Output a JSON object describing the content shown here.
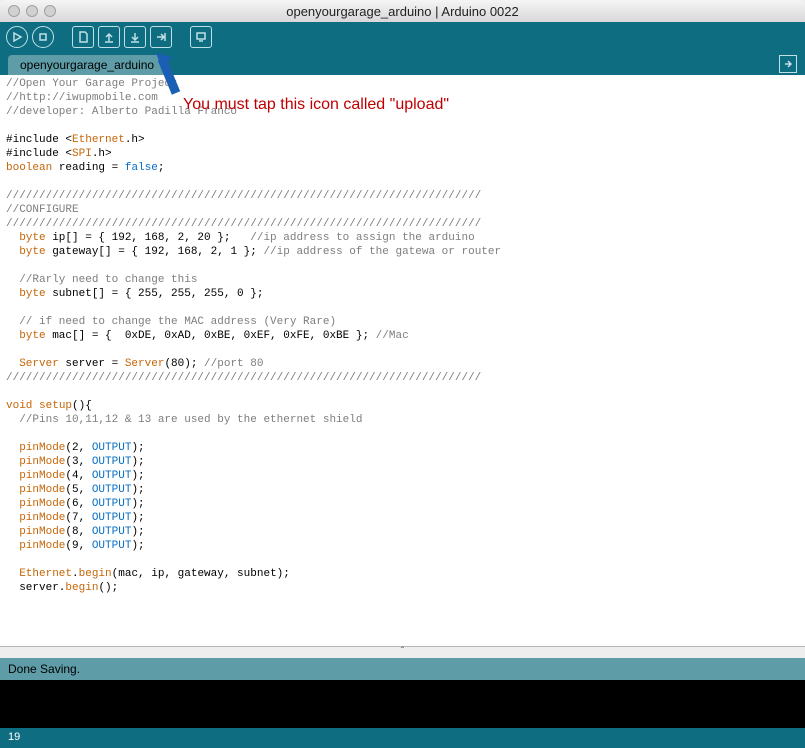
{
  "window": {
    "title": "openyourgarage_arduino | Arduino 0022"
  },
  "tabs": {
    "active": "openyourgarage_arduino"
  },
  "annotation": {
    "text": "You must tap this icon called \"upload\""
  },
  "status": {
    "message": "Done Saving."
  },
  "footer": {
    "line": "19"
  },
  "code": {
    "raw": "//Open Your Garage Project\n//http://iwupmobile.com\n//developer: Alberto Padilla Franco\n\n#include <Ethernet.h>\n#include <SPI.h>\nboolean reading = false;\n\n////////////////////////////////////////////////////////////////////////\n//CONFIGURE\n////////////////////////////////////////////////////////////////////////\n  byte ip[] = { 192, 168, 2, 20 };   //ip address to assign the arduino\n  byte gateway[] = { 192, 168, 2, 1 }; //ip address of the gatewa or router\n\n  //Rarly need to change this\n  byte subnet[] = { 255, 255, 255, 0 };\n\n  // if need to change the MAC address (Very Rare)\n  byte mac[] = {  0xDE, 0xAD, 0xBE, 0xEF, 0xFE, 0xBE }; //Mac\n\n  Server server = Server(80); //port 80\n////////////////////////////////////////////////////////////////////////\n\nvoid setup(){\n  //Pins 10,11,12 & 13 are used by the ethernet shield\n\n  pinMode(2, OUTPUT);\n  pinMode(3, OUTPUT);\n  pinMode(4, OUTPUT);\n  pinMode(5, OUTPUT);\n  pinMode(6, OUTPUT);\n  pinMode(7, OUTPUT);\n  pinMode(8, OUTPUT);\n  pinMode(9, OUTPUT);\n\n  Ethernet.begin(mac, ip, gateway, subnet);\n  server.begin();\n"
  },
  "toolbar": {
    "buttons": [
      "verify",
      "stop",
      "new",
      "open",
      "save",
      "upload",
      "serial-monitor"
    ]
  },
  "colors": {
    "teal_dark": "#0e6d80",
    "teal_light": "#5e9da8",
    "annotation_red": "#c00000"
  }
}
